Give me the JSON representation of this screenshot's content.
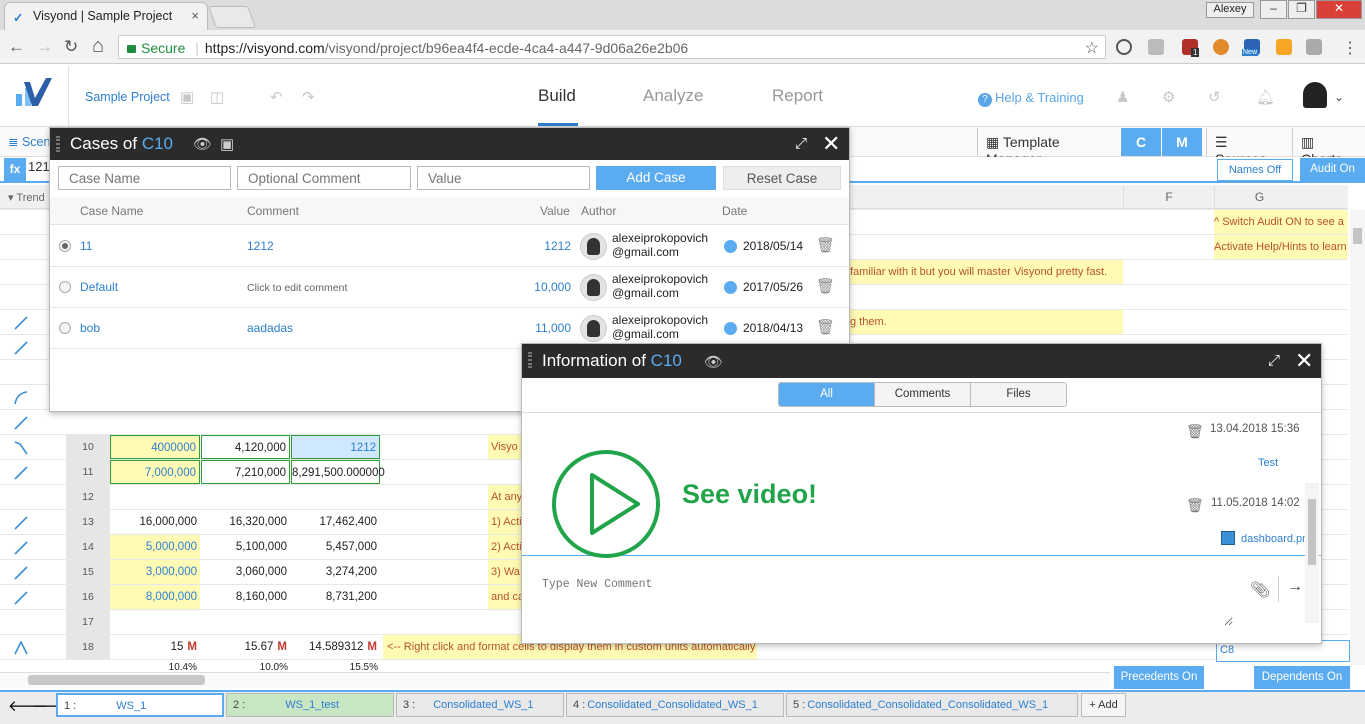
{
  "browser": {
    "tab_title": "Visyond | Sample Project",
    "tab_close": "×",
    "user": "Alexey",
    "win_min": "–",
    "win_max": "❐",
    "win_close": "✕",
    "secure_label": "Secure",
    "url_host": "https://visyond.com",
    "url_path": "/visyond/project/b96ea4f4-ecde-4ca4-a447-9d06a26e2b06",
    "nav_back": "←",
    "nav_forward": "→",
    "nav_reload": "↻",
    "nav_home": "⌂",
    "star": "☆",
    "ext_badge": "1",
    "ext_new": "New"
  },
  "app": {
    "project_name": "Sample Project",
    "nav": [
      "Build",
      "Analyze",
      "Report"
    ],
    "help_label": "Help & Training",
    "help_q": "?",
    "avatar_chevron": "⌄"
  },
  "toolbar": {
    "scenario_tab": "Scen",
    "template_manager": "Template Manager",
    "c": "C",
    "m": "M",
    "sources": "Sources",
    "charts": "Charts"
  },
  "formula": {
    "fx": "fx",
    "value": "121",
    "names_off": "Names Off",
    "audit_on": "Audit On"
  },
  "grid": {
    "trend_header": "Trend",
    "columns": [
      "F",
      "G"
    ],
    "g_notes": [
      "^ Switch Audit ON to see a",
      "Activate Help/Hints to learn"
    ],
    "banner_1": "familiar with it but you will master Visyond pretty fast.",
    "banner_2": "g them.",
    "rows": [
      {
        "n": "10",
        "a": "4000000",
        "b": "4,120,000",
        "c": "1212",
        "note": "Visyo",
        "ay": true
      },
      {
        "n": "11",
        "a": "7,000,000",
        "b": "7,210,000",
        "c": "8,291,500.000000",
        "note": "",
        "ay": true
      },
      {
        "n": "12",
        "a": "",
        "b": "",
        "c": "",
        "note": "At any",
        "ay": false
      },
      {
        "n": "13",
        "a": "16,000,000",
        "b": "16,320,000",
        "c": "17,462,400",
        "note": "1) Acti",
        "ay": false
      },
      {
        "n": "14",
        "a": "5,000,000",
        "b": "5,100,000",
        "c": "5,457,000",
        "note": "2) Acti",
        "ay": true
      },
      {
        "n": "15",
        "a": "3,000,000",
        "b": "3,060,000",
        "c": "3,274,200",
        "note": "3) Wa",
        "ay": true
      },
      {
        "n": "16",
        "a": "8,000,000",
        "b": "8,160,000",
        "c": "8,731,200",
        "note": "and ca",
        "ay": true
      },
      {
        "n": "17",
        "a": "",
        "b": "",
        "c": "",
        "note": "",
        "ay": false
      },
      {
        "n": "18",
        "a": "15",
        "b": "15.67",
        "c": "14.589312",
        "note": "<-- Right click and format cells to display them in custom units automatically",
        "ay": false
      }
    ],
    "unit_m": "M",
    "row19": [
      "10.4%",
      "10.0%",
      "15.5%"
    ],
    "c8": "C8",
    "precedents_on": "Precedents On",
    "dependents_on": "Dependents On"
  },
  "sheets": [
    {
      "num": "1 :",
      "name": "WS_1"
    },
    {
      "num": "2 :",
      "name": "WS_1_test"
    },
    {
      "num": "3 :",
      "name": "Consolidated_WS_1"
    },
    {
      "num": "4 :",
      "name": "Consolidated_Consolidated_WS_1"
    },
    {
      "num": "5 :",
      "name": "Consolidated_Consolidated_Consolidated_WS_1"
    }
  ],
  "sheet_nav": {
    "prev": "🡐",
    "next": "🡒"
  },
  "add_sheet": "+ Add",
  "cases_dialog": {
    "title_prefix": "Cases of ",
    "title_cell": "C10",
    "placeholders": {
      "name": "Case Name",
      "comment": "Optional Comment",
      "value": "Value"
    },
    "add_case": "Add Case",
    "reset_case": "Reset Case",
    "headers": {
      "name": "Case Name",
      "comment": "Comment",
      "value": "Value",
      "author": "Author",
      "date": "Date"
    },
    "cases": [
      {
        "name": "11",
        "comment": "1212",
        "value": "1212",
        "author1": "alexeiprokopovich",
        "author2": "@gmail.com",
        "date": "2018/05/14",
        "selected": true
      },
      {
        "name": "Default",
        "comment": "Click to edit comment",
        "value": "10,000",
        "author1": "alexeiprokopovich",
        "author2": "@gmail.com",
        "date": "2017/05/26",
        "selected": false
      },
      {
        "name": "bob",
        "comment": "aadadas",
        "value": "11,000",
        "author1": "alexeiprokopovich",
        "author2": "@gmail.com",
        "date": "2018/04/13",
        "selected": false
      }
    ]
  },
  "info_dialog": {
    "title_prefix": "Information of ",
    "title_cell": "C10",
    "tabs": [
      "All",
      "Comments",
      "Files"
    ],
    "video_label": "See video!",
    "entries": [
      {
        "date": "13.04.2018 15:36",
        "text": "Test"
      },
      {
        "date": "11.05.2018 14:02",
        "file": "dashboard.png"
      }
    ],
    "comment_placeholder": "Type New Comment"
  },
  "icons": {
    "eye": "eye-icon",
    "image": "image-icon",
    "expand": "expand-icon",
    "close": "close-icon",
    "trash": "trash-icon",
    "clock": "clock-icon",
    "paperclip": "paperclip-icon",
    "send": "arrow-right-icon"
  },
  "colors": {
    "accent": "#5aabf0",
    "link": "#2d7fd0",
    "highlight": "#fffbb5",
    "note_text": "#b8522c",
    "video_green": "#22a44a"
  }
}
